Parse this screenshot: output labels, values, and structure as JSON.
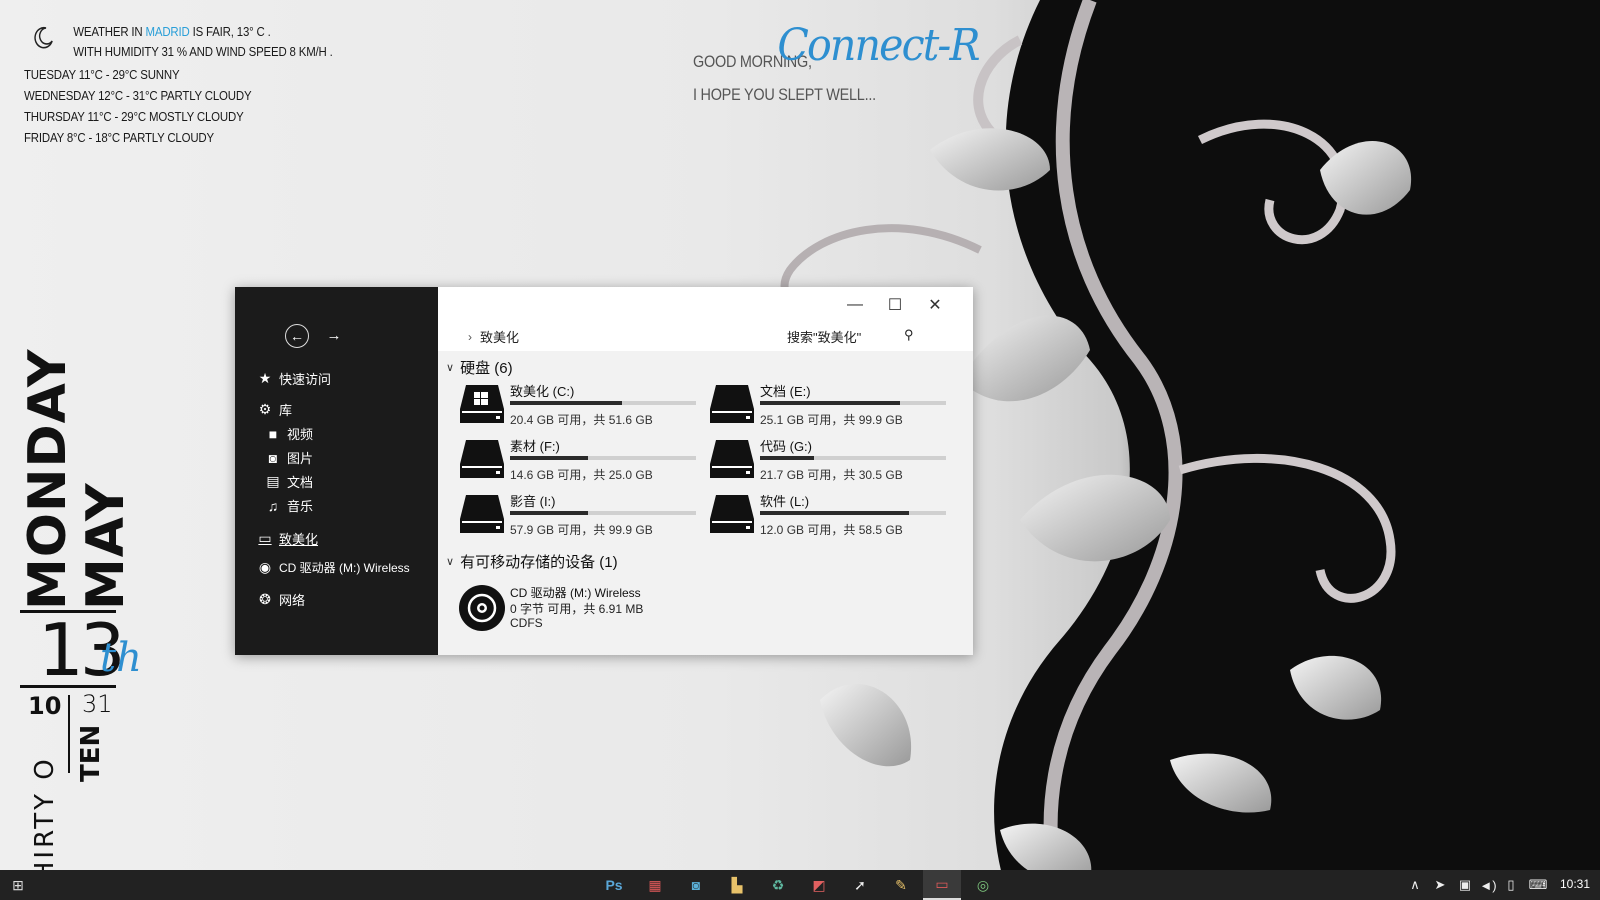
{
  "weather": {
    "line1_prefix": "Weather in",
    "city": "Madrid",
    "line1_suffix": "is fair, 13° C .",
    "line2": "with humidity 31 % and wind speed 8 Km/h .",
    "forecast": [
      "Tuesday  11°C - 29°C  Sunny",
      "Wednesday  12°C - 31°C  Partly Cloudy",
      "Thursday  11°C - 29°C  Mostly Cloudy",
      "Friday  8°C - 18°C  Partly Cloudy"
    ]
  },
  "greeting": {
    "line1": "Good Morning,",
    "signature": "Connect-R",
    "line2": "I hope you slept well..."
  },
  "clock": {
    "day": "MONDAY",
    "month": "MAY",
    "date": "13",
    "suffix": "th",
    "hour": "10",
    "minute": "31",
    "minute_word": "THIRTY O",
    "hour_word": "TEN"
  },
  "explorer": {
    "nav": {
      "quick_access": "快速访问",
      "library": "库",
      "videos": "视频",
      "pictures": "图片",
      "documents": "文档",
      "music": "音乐",
      "this_pc": "致美化",
      "cd_drive": "CD 驱动器 (M:) Wireless",
      "network": "网络"
    },
    "address": "致美化",
    "search_placeholder": "搜索\"致美化\"",
    "group_hdd": "硬盘 (6)",
    "group_removable": "有可移动存储的设备 (1)",
    "drives": [
      {
        "name": "致美化 (C:)",
        "info": "20.4 GB 可用，共 51.6 GB",
        "used": 0.6
      },
      {
        "name": "文档 (E:)",
        "info": "25.1 GB 可用，共 99.9 GB",
        "used": 0.75
      },
      {
        "name": "素材 (F:)",
        "info": "14.6 GB 可用，共 25.0 GB",
        "used": 0.42
      },
      {
        "name": "代码 (G:)",
        "info": "21.7 GB 可用，共 30.5 GB",
        "used": 0.29
      },
      {
        "name": "影音 (I:)",
        "info": "57.9 GB 可用，共 99.9 GB",
        "used": 0.42
      },
      {
        "name": "软件 (L:)",
        "info": "12.0 GB 可用，共 58.5 GB",
        "used": 0.8
      }
    ],
    "cd": {
      "name": "CD 驱动器 (M:) Wireless",
      "info": "0 字节 可用，共 6.91 MB",
      "fs": "CDFS"
    }
  },
  "taskbar": {
    "time": "10:31",
    "ps_label": "Ps"
  }
}
